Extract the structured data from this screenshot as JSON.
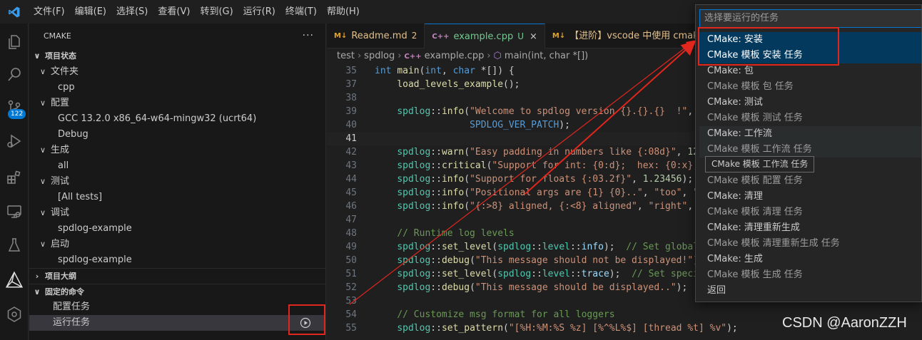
{
  "menu": [
    "文件(F)",
    "编辑(E)",
    "选择(S)",
    "查看(V)",
    "转到(G)",
    "运行(R)",
    "终端(T)",
    "帮助(H)"
  ],
  "activity": {
    "scm_badge": "122"
  },
  "sidebar": {
    "title": "CMAKE",
    "more": "···",
    "rows": [
      {
        "label": "项目状态",
        "level": 0,
        "kind": "section",
        "expanded": true
      },
      {
        "label": "文件夹",
        "level": 1,
        "kind": "group",
        "expanded": true
      },
      {
        "label": "cpp",
        "level": 2,
        "kind": "item"
      },
      {
        "label": "配置",
        "level": 1,
        "kind": "group",
        "expanded": true
      },
      {
        "label": "GCC 13.2.0 x86_64-w64-mingw32 (ucrt64)",
        "level": 2,
        "kind": "item"
      },
      {
        "label": "Debug",
        "level": 2,
        "kind": "item"
      },
      {
        "label": "生成",
        "level": 1,
        "kind": "group",
        "expanded": true
      },
      {
        "label": "all",
        "level": 2,
        "kind": "item"
      },
      {
        "label": "测试",
        "level": 1,
        "kind": "group",
        "expanded": true
      },
      {
        "label": "[All tests]",
        "level": 2,
        "kind": "item"
      },
      {
        "label": "调试",
        "level": 1,
        "kind": "group",
        "expanded": true
      },
      {
        "label": "spdlog-example",
        "level": 2,
        "kind": "item"
      },
      {
        "label": "启动",
        "level": 1,
        "kind": "group",
        "expanded": true
      },
      {
        "label": "spdlog-example",
        "level": 2,
        "kind": "item"
      },
      {
        "label": "项目大纲",
        "level": 0,
        "kind": "section",
        "expanded": false
      },
      {
        "label": "固定的命令",
        "level": 0,
        "kind": "section",
        "expanded": true
      },
      {
        "label": "配置任务",
        "level": 1,
        "kind": "command"
      },
      {
        "label": "运行任务",
        "level": 1,
        "kind": "command",
        "selected": true
      }
    ]
  },
  "tabs": [
    {
      "icon": "M↓",
      "label": "Readme.md",
      "mod": "2",
      "active": false,
      "icon_color": "#e2a42a"
    },
    {
      "icon": "C++",
      "label": "example.cpp",
      "mod": "U",
      "active": true,
      "close": "×",
      "icon_color": "#c586c0"
    },
    {
      "icon": "M↓",
      "label": "【进阶】vscode 中使用 cmake 编译",
      "mod": "",
      "active": false,
      "icon_color": "#e2a42a"
    }
  ],
  "breadcrumb": [
    "test",
    "spdlog",
    "example.cpp",
    "main(int, char *[])"
  ],
  "code": {
    "current_line": "41",
    "lines": [
      {
        "n": "35",
        "tokens": [
          [
            "kw",
            "int"
          ],
          [
            "op",
            " "
          ],
          [
            "fn",
            "main"
          ],
          [
            "op",
            "("
          ],
          [
            "kw",
            "int"
          ],
          [
            "op",
            ", "
          ],
          [
            "kw",
            "char"
          ],
          [
            "op",
            " *[]) {"
          ]
        ]
      },
      {
        "n": "37",
        "tokens": [
          [
            "op",
            "    "
          ],
          [
            "fn",
            "load_levels_example"
          ],
          [
            "op",
            "();"
          ]
        ]
      },
      {
        "n": "38",
        "tokens": []
      },
      {
        "n": "39",
        "tokens": [
          [
            "op",
            "    "
          ],
          [
            "ns",
            "spdlog"
          ],
          [
            "op",
            "::"
          ],
          [
            "fn",
            "info"
          ],
          [
            "op",
            "("
          ],
          [
            "str",
            "\"Welcome to spdlog version {}.{}.{}  !\""
          ],
          [
            "op",
            ", "
          ]
        ]
      },
      {
        "n": "40",
        "tokens": [
          [
            "op",
            "                 "
          ],
          [
            "mac",
            "SPDLOG_VER_PATCH"
          ],
          [
            "op",
            ");"
          ]
        ]
      },
      {
        "n": "41",
        "tokens": []
      },
      {
        "n": "42",
        "tokens": [
          [
            "op",
            "    "
          ],
          [
            "ns",
            "spdlog"
          ],
          [
            "op",
            "::"
          ],
          [
            "fn",
            "warn"
          ],
          [
            "op",
            "("
          ],
          [
            "str",
            "\"Easy padding in numbers like {:08d}\""
          ],
          [
            "op",
            ", "
          ],
          [
            "num",
            "12"
          ]
        ]
      },
      {
        "n": "43",
        "tokens": [
          [
            "op",
            "    "
          ],
          [
            "ns",
            "spdlog"
          ],
          [
            "op",
            "::"
          ],
          [
            "fn",
            "critical"
          ],
          [
            "op",
            "("
          ],
          [
            "str",
            "\"Support for int: {0:d};  hex: {0:x};"
          ]
        ]
      },
      {
        "n": "44",
        "tokens": [
          [
            "op",
            "    "
          ],
          [
            "ns",
            "spdlog"
          ],
          [
            "op",
            "::"
          ],
          [
            "fn",
            "info"
          ],
          [
            "op",
            "("
          ],
          [
            "str",
            "\"Support for floats {:03.2f}\""
          ],
          [
            "op",
            ", "
          ],
          [
            "num",
            "1.23456"
          ],
          [
            "op",
            ");"
          ]
        ]
      },
      {
        "n": "45",
        "tokens": [
          [
            "op",
            "    "
          ],
          [
            "ns",
            "spdlog"
          ],
          [
            "op",
            "::"
          ],
          [
            "fn",
            "info"
          ],
          [
            "op",
            "("
          ],
          [
            "str",
            "\"Positional args are {1} {0}..\""
          ],
          [
            "op",
            ", "
          ],
          [
            "str",
            "\"too\""
          ],
          [
            "op",
            ", "
          ],
          [
            "str",
            "\""
          ]
        ]
      },
      {
        "n": "46",
        "tokens": [
          [
            "op",
            "    "
          ],
          [
            "ns",
            "spdlog"
          ],
          [
            "op",
            "::"
          ],
          [
            "fn",
            "info"
          ],
          [
            "op",
            "("
          ],
          [
            "str",
            "\"{:>8} aligned, {:<8} aligned\""
          ],
          [
            "op",
            ", "
          ],
          [
            "str",
            "\"right\""
          ],
          [
            "op",
            ", "
          ]
        ]
      },
      {
        "n": "47",
        "tokens": []
      },
      {
        "n": "48",
        "tokens": [
          [
            "op",
            "    "
          ],
          [
            "cm",
            "// Runtime log levels"
          ]
        ]
      },
      {
        "n": "49",
        "tokens": [
          [
            "op",
            "    "
          ],
          [
            "ns",
            "spdlog"
          ],
          [
            "op",
            "::"
          ],
          [
            "fn",
            "set_level"
          ],
          [
            "op",
            "("
          ],
          [
            "ns",
            "spdlog"
          ],
          [
            "op",
            "::"
          ],
          [
            "ns",
            "level"
          ],
          [
            "op",
            "::"
          ],
          [
            "var",
            "info"
          ],
          [
            "op",
            ");  "
          ],
          [
            "cm",
            "// Set global"
          ]
        ]
      },
      {
        "n": "50",
        "tokens": [
          [
            "op",
            "    "
          ],
          [
            "ns",
            "spdlog"
          ],
          [
            "op",
            "::"
          ],
          [
            "fn",
            "debug"
          ],
          [
            "op",
            "("
          ],
          [
            "str",
            "\"This message should not be displayed!\""
          ],
          [
            "op",
            ")"
          ]
        ]
      },
      {
        "n": "51",
        "tokens": [
          [
            "op",
            "    "
          ],
          [
            "ns",
            "spdlog"
          ],
          [
            "op",
            "::"
          ],
          [
            "fn",
            "set_level"
          ],
          [
            "op",
            "("
          ],
          [
            "ns",
            "spdlog"
          ],
          [
            "op",
            "::"
          ],
          [
            "ns",
            "level"
          ],
          [
            "op",
            "::"
          ],
          [
            "var",
            "trace"
          ],
          [
            "op",
            ");  "
          ],
          [
            "cm",
            "// Set speci"
          ]
        ]
      },
      {
        "n": "52",
        "tokens": [
          [
            "op",
            "    "
          ],
          [
            "ns",
            "spdlog"
          ],
          [
            "op",
            "::"
          ],
          [
            "fn",
            "debug"
          ],
          [
            "op",
            "("
          ],
          [
            "str",
            "\"This message should be displayed..\""
          ],
          [
            "op",
            ");"
          ]
        ]
      },
      {
        "n": "53",
        "tokens": []
      },
      {
        "n": "54",
        "tokens": [
          [
            "op",
            "    "
          ],
          [
            "cm",
            "// Customize msg format for all loggers"
          ]
        ]
      },
      {
        "n": "55",
        "tokens": [
          [
            "op",
            "    "
          ],
          [
            "ns",
            "spdlog"
          ],
          [
            "op",
            "::"
          ],
          [
            "fn",
            "set_pattern"
          ],
          [
            "op",
            "("
          ],
          [
            "str",
            "\"[%H:%M:%S %z] [%^%L%$] [thread %t] %v\""
          ],
          [
            "op",
            ");"
          ]
        ]
      }
    ]
  },
  "quickpick": {
    "placeholder": "选择要运行的任务",
    "items": [
      {
        "title": "CMake: 安装",
        "desc": "CMake 模板 安装 任务",
        "selected": true
      },
      {
        "title": "CMake: 包",
        "desc": "CMake 模板 包 任务"
      },
      {
        "title": "CMake: 测试",
        "desc": "CMake 模板 测试 任务"
      },
      {
        "title": "CMake: 工作流",
        "desc": "CMake 模板 工作流 任务",
        "hover": true
      },
      {
        "title": "CMake: 配置",
        "desc": "CMake 模板 配置 任务"
      },
      {
        "title": "CMake: 清理",
        "desc": "CMake 模板 清理 任务"
      },
      {
        "title": "CMake: 清理重新生成",
        "desc": "CMake 模板 清理重新生成 任务"
      },
      {
        "title": "CMake: 生成",
        "desc": "CMake 模板 生成 任务"
      }
    ],
    "back": "返回",
    "tooltip": "CMake 模板 工作流 任务"
  },
  "watermark": "CSDN @AaronZZH",
  "colors": {
    "accent": "#0078d4",
    "annotation": "#e0261d",
    "selection": "#04395e"
  }
}
